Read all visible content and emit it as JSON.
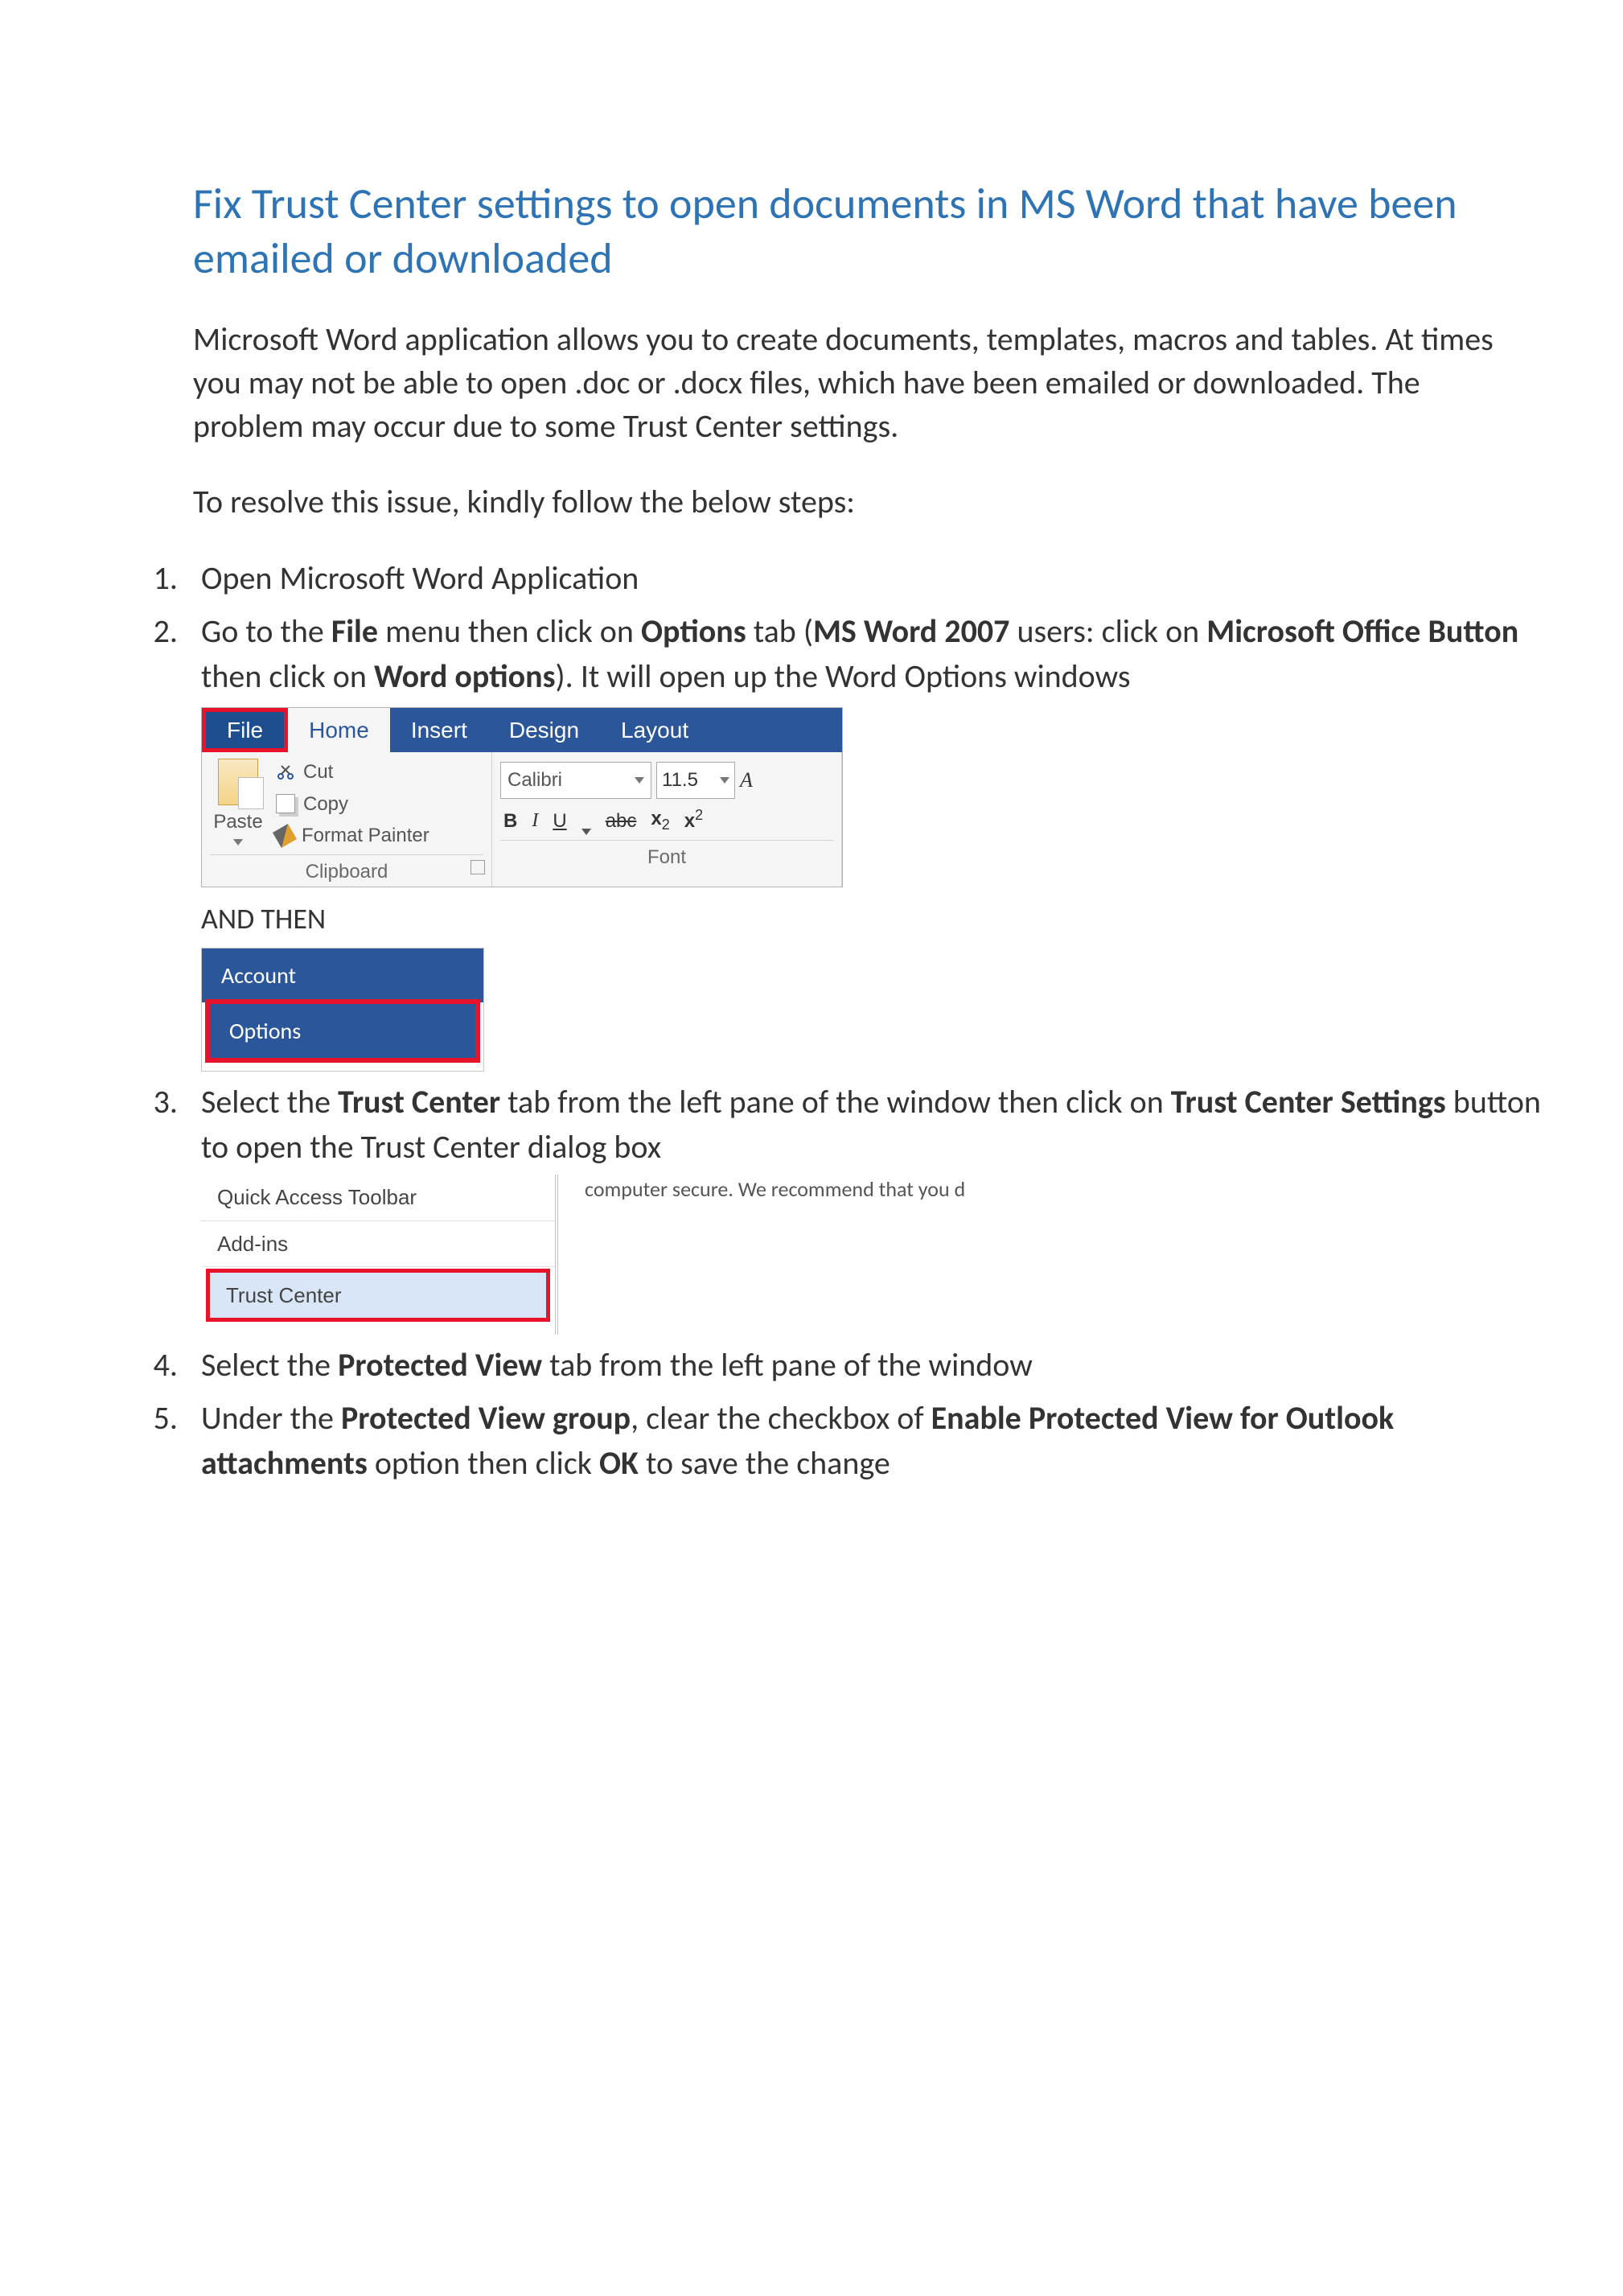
{
  "title": "Fix Trust Center settings to open documents in MS Word that have been emailed or downloaded",
  "intro": "Microsoft Word application allows you to create documents, templates, macros and tables. At times you may not be able to open .doc or .docx files, which have been emailed or downloaded. The problem may occur due to some Trust Center settings.",
  "resolve": "To resolve this issue, kindly follow the below steps:",
  "steps": {
    "s1": "Open Microsoft Word Application",
    "s2_a": "Go to the ",
    "s2_file": "File",
    "s2_b": " menu then click on ",
    "s2_options": "Options",
    "s2_c": " tab (",
    "s2_2007": "MS Word 2007",
    "s2_d": " users: click on ",
    "s2_mob": "Microsoft Office Button",
    "s2_e": " then click on ",
    "s2_wopt": "Word options",
    "s2_f": "). It will open up the Word Options windows",
    "and_then": "AND THEN",
    "s3_a": "Select the ",
    "s3_tc": "Trust Center",
    "s3_b": " tab from the left pane of the window then click on ",
    "s3_tcs": "Trust Center Settings",
    "s3_c": " button to open the Trust Center dialog box",
    "s4_a": "Select the ",
    "s4_pv": "Protected View",
    "s4_b": " tab from the left pane of the window",
    "s5_a": "Under the ",
    "s5_pvg": "Protected View group",
    "s5_b": ", clear the checkbox of ",
    "s5_epv": "Enable Protected View for Outlook attachments",
    "s5_c": " option then click ",
    "s5_ok": "OK",
    "s5_d": " to save the change"
  },
  "ribbon": {
    "tabs": {
      "file": "File",
      "home": "Home",
      "insert": "Insert",
      "design": "Design",
      "layout": "Layout"
    },
    "clipboard": {
      "paste": "Paste",
      "cut": "Cut",
      "copy": "Copy",
      "format_painter": "Format Painter",
      "caption": "Clipboard"
    },
    "font": {
      "name": "Calibri",
      "size": "11.5",
      "a_partial": "A",
      "b": "B",
      "i": "I",
      "u": "U",
      "abc": "abc",
      "x2": "x",
      "x2s": "2",
      "x2u": "x",
      "x2us": "2",
      "caption": "Font"
    }
  },
  "menu": {
    "account": "Account",
    "options": "Options"
  },
  "options_pane": {
    "qat": "Quick Access Toolbar",
    "addins": "Add-ins",
    "trust_center": "Trust Center",
    "right_text": "computer secure. We recommend that you d"
  }
}
